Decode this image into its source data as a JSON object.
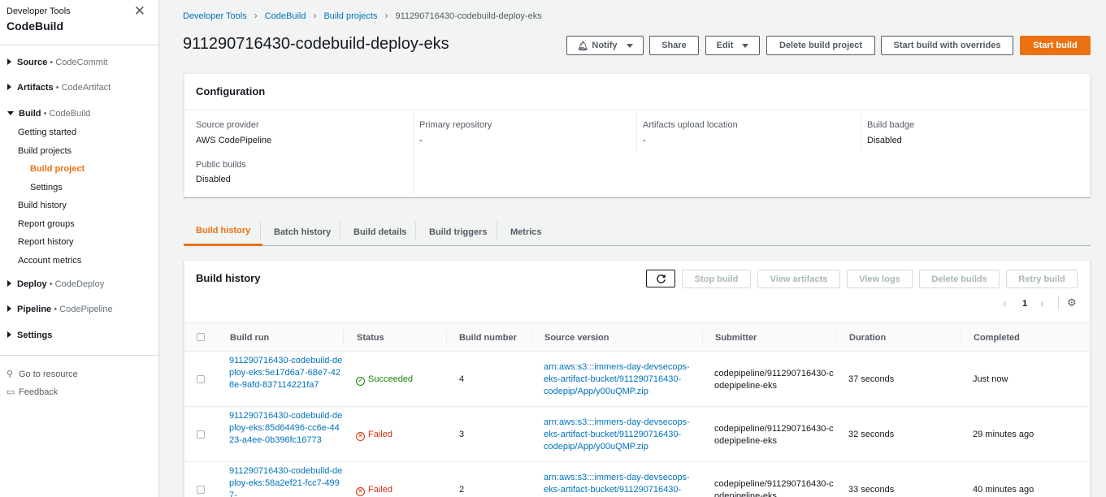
{
  "sidebar": {
    "super_title": "Developer Tools",
    "title": "CodeBuild",
    "sections": [
      {
        "label": "Source",
        "service": "• CodeCommit"
      },
      {
        "label": "Artifacts",
        "service": "• CodeArtifact"
      },
      {
        "label": "Build",
        "service": "• CodeBuild"
      },
      {
        "label": "Deploy",
        "service": "• CodeDeploy"
      },
      {
        "label": "Pipeline",
        "service": "• CodePipeline"
      },
      {
        "label": "Settings",
        "service": ""
      }
    ],
    "build_items": [
      "Getting started",
      "Build projects",
      "Build project",
      "Settings",
      "Build history",
      "Report groups",
      "Report history",
      "Account metrics"
    ],
    "tools": [
      "Go to resource",
      "Feedback"
    ]
  },
  "breadcrumb": [
    "Developer Tools",
    "CodeBuild",
    "Build projects",
    "911290716430-codebuild-deploy-eks"
  ],
  "page_title": "911290716430-codebuild-deploy-eks",
  "actions": {
    "notify": "Notify",
    "share": "Share",
    "edit": "Edit",
    "delete": "Delete build project",
    "start_overrides": "Start build with overrides",
    "start": "Start build"
  },
  "configuration": {
    "title": "Configuration",
    "fields": [
      {
        "label": "Source provider",
        "value": "AWS CodePipeline"
      },
      {
        "label": "Primary repository",
        "value": "-"
      },
      {
        "label": "Artifacts upload location",
        "value": "-"
      },
      {
        "label": "Build badge",
        "value": "Disabled"
      },
      {
        "label": "Public builds",
        "value": "Disabled"
      }
    ]
  },
  "tabs": [
    "Build history",
    "Batch history",
    "Build details",
    "Build triggers",
    "Metrics"
  ],
  "build_history": {
    "title": "Build history",
    "buttons": {
      "stop": "Stop build",
      "artifacts": "View artifacts",
      "logs": "View logs",
      "delete": "Delete builds",
      "retry": "Retry build"
    },
    "page": "1",
    "columns": [
      "Build run",
      "Status",
      "Build number",
      "Source version",
      "Submitter",
      "Duration",
      "Completed"
    ],
    "rows": [
      {
        "run": "911290716430-codebuild-deploy-eks:5e17d6a7-68e7-428e-9afd-837114221fa7",
        "status": "Succeeded",
        "number": "4",
        "source": "arn:aws:s3:::immers-day-devsecops-eks-artifact-bucket/911290716430-codepip/App/y00uQMP.zip",
        "submitter": "codepipeline/911290716430-codepipeline-eks",
        "duration": "37 seconds",
        "completed": "Just now"
      },
      {
        "run": "911290716430-codebuild-deploy-eks:85d64496-cc6e-4423-a4ee-0b396fc16773",
        "status": "Failed",
        "number": "3",
        "source": "arn:aws:s3:::immers-day-devsecops-eks-artifact-bucket/911290716430-codepip/App/y00uQMP.zip",
        "submitter": "codepipeline/911290716430-codepipeline-eks",
        "duration": "32 seconds",
        "completed": "29 minutes ago"
      },
      {
        "run": "911290716430-codebuild-deploy-eks:58a2ef21-fcc7-4997-",
        "status": "Failed",
        "number": "2",
        "source": "arn:aws:s3:::immers-day-devsecops-eks-artifact-bucket/911290716430-",
        "submitter": "codepipeline/911290716430-codepipeline-eks",
        "duration": "33 seconds",
        "completed": "40 minutes ago"
      }
    ]
  }
}
